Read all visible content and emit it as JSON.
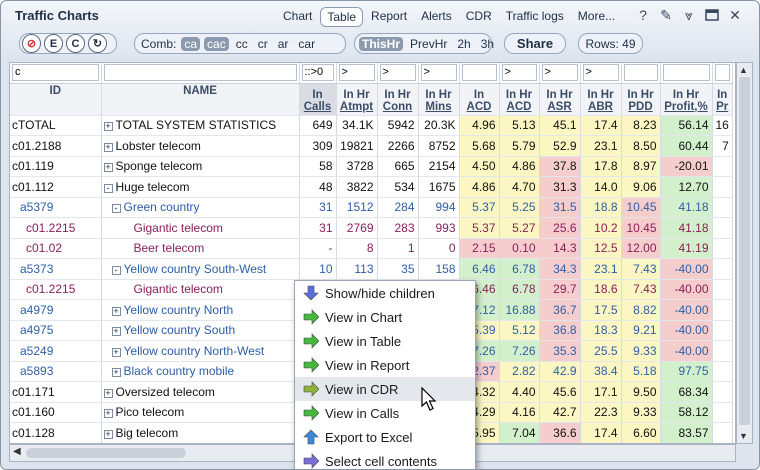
{
  "window": {
    "title": "Traffic Charts"
  },
  "tabs": [
    "Chart",
    "Table",
    "Report",
    "Alerts",
    "CDR",
    "Traffic logs",
    "More..."
  ],
  "toolbar": {
    "btn_e": "E",
    "btn_c": "C",
    "comb_label": "Comb:",
    "comb_opts": [
      "ca",
      "cac",
      "cc",
      "cr",
      "ar",
      "car"
    ],
    "periods": [
      "ThisHr",
      "PrevHr",
      "2h",
      "3h"
    ],
    "share": "Share",
    "rows": "Rows: 49"
  },
  "filters": {
    "id": "c",
    "calls": "::>0",
    "gt": ">"
  },
  "headers": [
    [
      "ID"
    ],
    [
      "NAME"
    ],
    [
      "In",
      "Calls"
    ],
    [
      "In Hr",
      "Atmpt"
    ],
    [
      "In Hr",
      "Conn"
    ],
    [
      "In Hr",
      "Mins"
    ],
    [
      "In",
      "ACD"
    ],
    [
      "In Hr",
      "ACD"
    ],
    [
      "In Hr",
      "ASR"
    ],
    [
      "In Hr",
      "ABR"
    ],
    [
      "In Hr",
      "PDD"
    ],
    [
      "In Hr",
      "Profit,%"
    ],
    [
      "In",
      "Pr"
    ]
  ],
  "rows": [
    {
      "id": "cTOTAL",
      "name": "TOTAL SYSTEM STATISTICS",
      "lvl": 0,
      "ex": "+",
      "v": [
        "649",
        "34.1K",
        "5942",
        "20.3K",
        "4.96",
        "5.13",
        "45.1",
        "17.4",
        "8.23",
        "56.14",
        "16"
      ],
      "c": [
        "",
        "",
        "",
        "",
        "y",
        "y",
        "y",
        "y",
        "y",
        "g",
        ""
      ]
    },
    {
      "id": "c01.2188",
      "name": "Lobster telecom",
      "lvl": 0,
      "ex": "+",
      "v": [
        "309",
        "19821",
        "2266",
        "8752",
        "5.68",
        "5.79",
        "52.9",
        "23.1",
        "8.50",
        "60.44",
        "7"
      ],
      "c": [
        "",
        "",
        "",
        "",
        "y",
        "y",
        "y",
        "y",
        "y",
        "g",
        ""
      ]
    },
    {
      "id": "c01.119",
      "name": "Sponge telecom",
      "lvl": 0,
      "ex": "+",
      "v": [
        "58",
        "3728",
        "665",
        "2154",
        "4.50",
        "4.86",
        "37.8",
        "17.8",
        "8.97",
        "-20.01",
        ""
      ],
      "c": [
        "",
        "",
        "",
        "",
        "y",
        "y",
        "r",
        "y",
        "y",
        "r",
        ""
      ]
    },
    {
      "id": "c01.112",
      "name": "Huge telecom",
      "lvl": 0,
      "ex": "-",
      "v": [
        "48",
        "3822",
        "534",
        "1675",
        "4.86",
        "4.70",
        "31.3",
        "14.0",
        "9.06",
        "12.70",
        ""
      ],
      "c": [
        "",
        "",
        "",
        "",
        "y",
        "y",
        "r",
        "y",
        "y",
        "g",
        ""
      ]
    },
    {
      "id": "a5379",
      "name": "Green country",
      "lvl": 1,
      "ex": "-",
      "v": [
        "31",
        "1512",
        "284",
        "994",
        "5.37",
        "5.25",
        "31.5",
        "18.8",
        "10.45",
        "41.18",
        ""
      ],
      "c": [
        "",
        "",
        "",
        "",
        "y",
        "y",
        "r",
        "y",
        "r",
        "g",
        ""
      ]
    },
    {
      "id": "c01.2215",
      "name": "Gigantic telecom",
      "lvl": 2,
      "ex": "",
      "v": [
        "31",
        "2769",
        "283",
        "993",
        "5.37",
        "5.27",
        "25.6",
        "10.2",
        "10.45",
        "41.18",
        ""
      ],
      "c": [
        "",
        "",
        "",
        "",
        "y",
        "y",
        "r",
        "y",
        "r",
        "g",
        ""
      ]
    },
    {
      "id": "c01.02",
      "name": "Beer telecom",
      "lvl": 2,
      "ex": "",
      "v": [
        "-",
        "8",
        "1",
        "0",
        "2.15",
        "0.10",
        "14.3",
        "12.5",
        "12.00",
        "41.19",
        ""
      ],
      "c": [
        "",
        "",
        "",
        "",
        "r",
        "r",
        "r",
        "y",
        "r",
        "g",
        ""
      ]
    },
    {
      "id": "a5373",
      "name": "Yellow country South-West",
      "lvl": 1,
      "ex": "-",
      "v": [
        "10",
        "113",
        "35",
        "158",
        "6.46",
        "6.78",
        "34.3",
        "23.1",
        "7.43",
        "-40.00",
        ""
      ],
      "c": [
        "",
        "",
        "",
        "",
        "g",
        "g",
        "r",
        "y",
        "y",
        "r",
        ""
      ]
    },
    {
      "id": "c01.2215",
      "name": "Gigantic telecom",
      "lvl": 2,
      "ex": "",
      "v": [
        "",
        "",
        "",
        "",
        "6.46",
        "6.78",
        "29.7",
        "18.6",
        "7.43",
        "-40.00",
        ""
      ],
      "c": [
        "",
        "",
        "",
        "",
        "g",
        "g",
        "r",
        "y",
        "y",
        "r",
        ""
      ]
    },
    {
      "id": "a4979",
      "name": "Yellow country North",
      "lvl": 1,
      "ex": "+",
      "v": [
        "",
        "",
        "",
        "",
        "7.12",
        "16.88",
        "36.7",
        "17.5",
        "8.82",
        "-40.00",
        ""
      ],
      "c": [
        "",
        "",
        "",
        "",
        "g",
        "g",
        "r",
        "y",
        "y",
        "r",
        ""
      ]
    },
    {
      "id": "a4975",
      "name": "Yellow country South",
      "lvl": 1,
      "ex": "+",
      "v": [
        "",
        "",
        "",
        "",
        "5.39",
        "5.12",
        "36.8",
        "18.3",
        "9.21",
        "-40.00",
        ""
      ],
      "c": [
        "",
        "",
        "",
        "",
        "y",
        "y",
        "r",
        "y",
        "y",
        "r",
        ""
      ]
    },
    {
      "id": "a5249",
      "name": "Yellow country North-West",
      "lvl": 1,
      "ex": "+",
      "v": [
        "",
        "",
        "",
        "",
        "7.26",
        "7.26",
        "35.3",
        "25.5",
        "9.33",
        "-40.00",
        ""
      ],
      "c": [
        "",
        "",
        "",
        "",
        "g",
        "g",
        "r",
        "y",
        "y",
        "r",
        ""
      ]
    },
    {
      "id": "a5893",
      "name": "Black country mobile",
      "lvl": 1,
      "ex": "+",
      "v": [
        "",
        "",
        "",
        "",
        "2.37",
        "2.82",
        "42.9",
        "38.4",
        "5.18",
        "97.75",
        ""
      ],
      "c": [
        "",
        "",
        "",
        "",
        "r",
        "y",
        "y",
        "y",
        "y",
        "g",
        ""
      ]
    },
    {
      "id": "c01.171",
      "name": "Oversized telecom",
      "lvl": 0,
      "ex": "+",
      "v": [
        "",
        "",
        "",
        "",
        "4.32",
        "4.40",
        "45.6",
        "17.1",
        "9.50",
        "68.34",
        ""
      ],
      "c": [
        "",
        "",
        "",
        "",
        "y",
        "y",
        "y",
        "y",
        "y",
        "g",
        ""
      ]
    },
    {
      "id": "c01.160",
      "name": "Pico telecom",
      "lvl": 0,
      "ex": "+",
      "v": [
        "",
        "",
        "",
        "",
        "4.29",
        "4.16",
        "42.7",
        "22.3",
        "9.33",
        "58.12",
        ""
      ],
      "c": [
        "",
        "",
        "",
        "",
        "y",
        "y",
        "y",
        "y",
        "y",
        "g",
        ""
      ]
    },
    {
      "id": "c01.128",
      "name": "Big telecom",
      "lvl": 0,
      "ex": "+",
      "v": [
        "",
        "",
        "",
        "",
        "5.95",
        "7.04",
        "36.6",
        "17.4",
        "6.60",
        "83.57",
        ""
      ],
      "c": [
        "",
        "",
        "",
        "",
        "y",
        "g",
        "r",
        "y",
        "y",
        "g",
        ""
      ]
    }
  ],
  "menu": [
    {
      "label": "Show/hide children",
      "icon": "arrow-down-icon",
      "color": "#5a6fd8"
    },
    {
      "label": "View in Chart",
      "icon": "arrow-right-icon",
      "color": "#45b83a"
    },
    {
      "label": "View in Table",
      "icon": "arrow-right-icon",
      "color": "#45b83a"
    },
    {
      "label": "View in Report",
      "icon": "arrow-right-icon",
      "color": "#45b83a"
    },
    {
      "label": "View in CDR",
      "icon": "arrow-right-icon",
      "color": "#8fb23a"
    },
    {
      "label": "View in Calls",
      "icon": "arrow-right-icon",
      "color": "#45b83a"
    },
    {
      "label": "Export to Excel",
      "icon": "arrow-up-icon",
      "color": "#3a8ad8"
    },
    {
      "label": "Select cell contents",
      "icon": "arrow-right-icon",
      "color": "#7a6fd8"
    }
  ]
}
